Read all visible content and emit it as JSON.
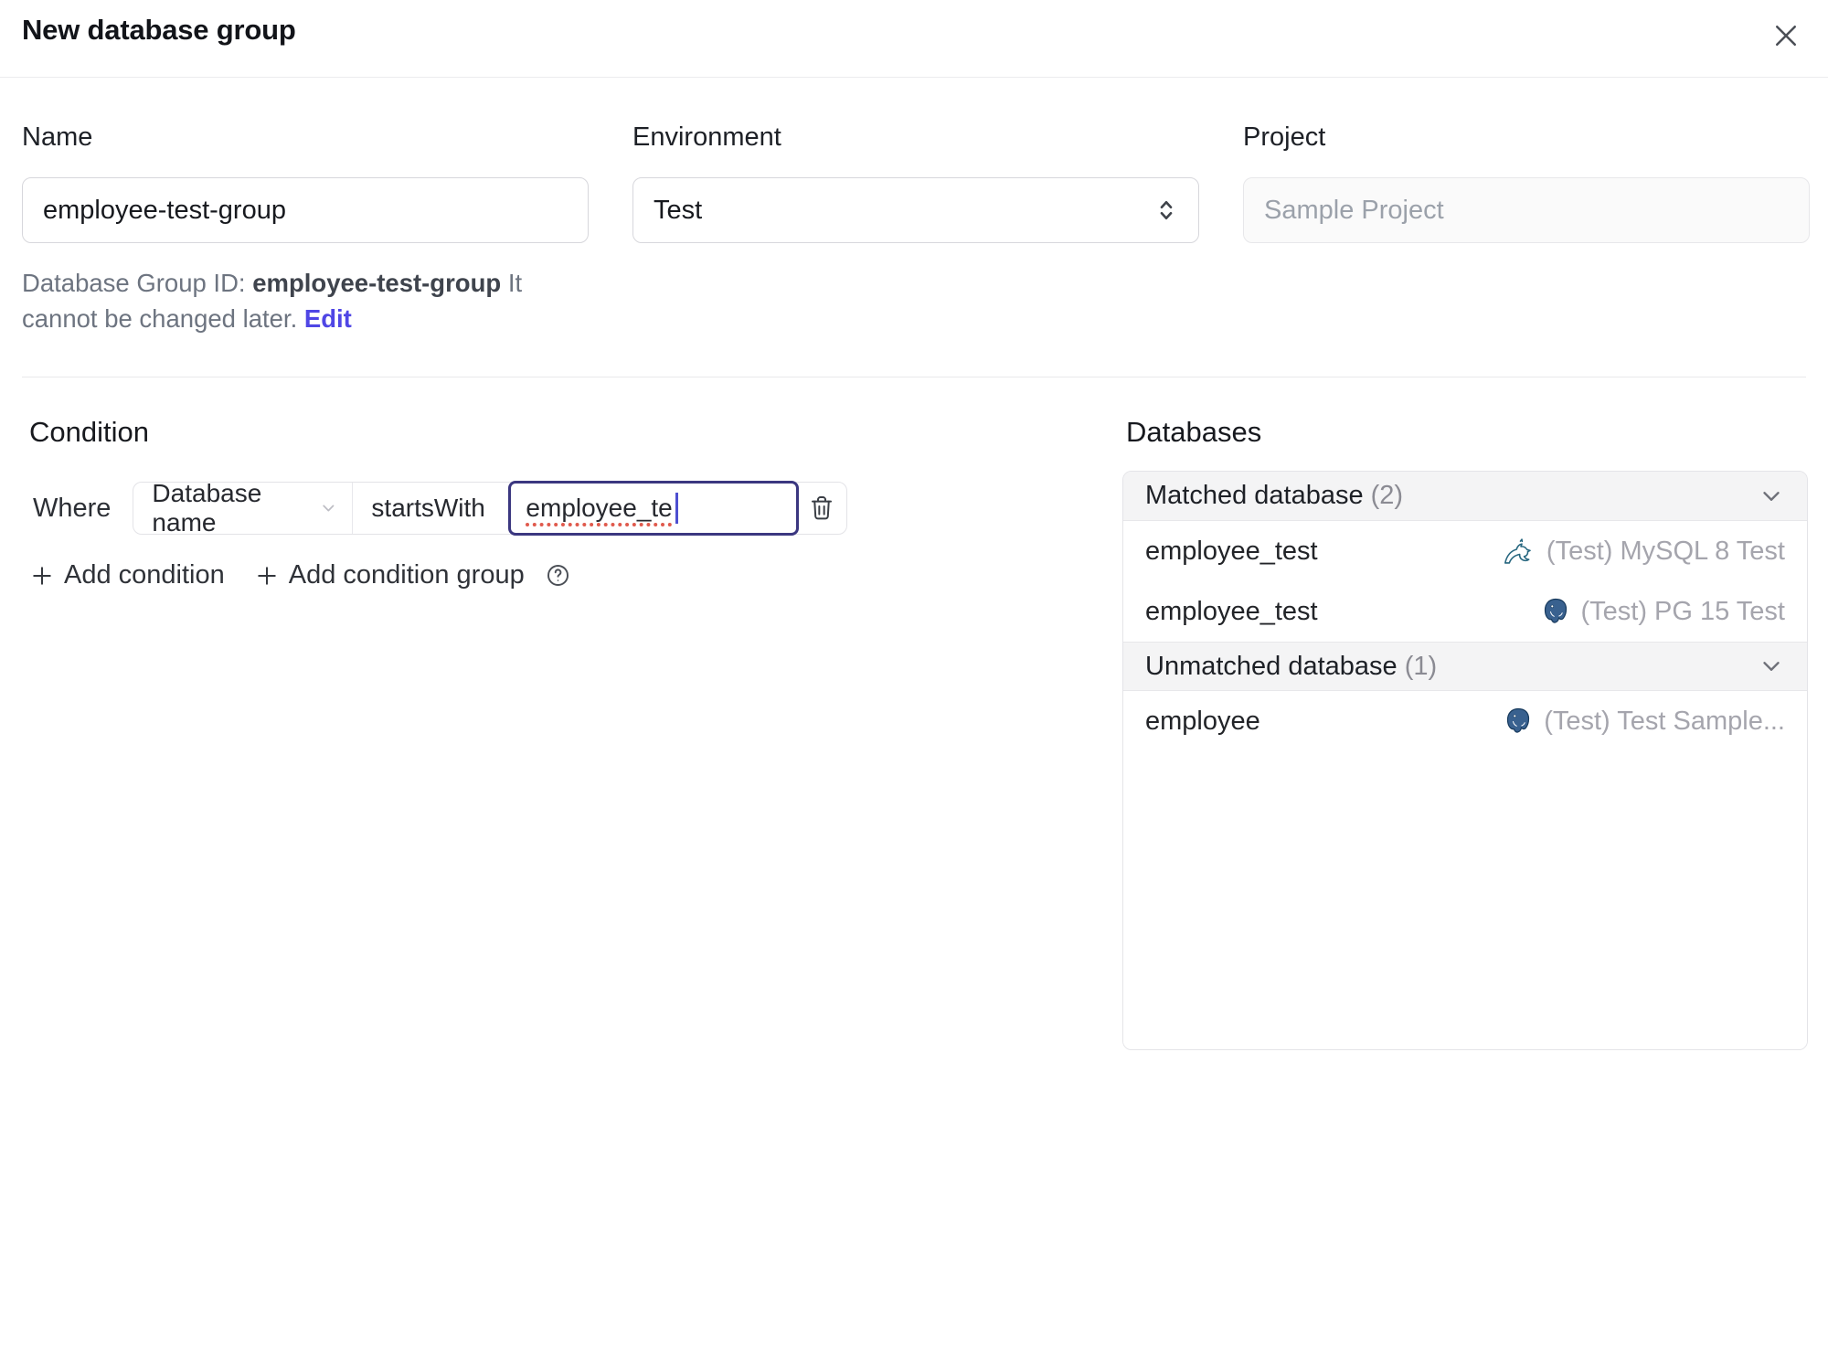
{
  "header": {
    "title": "New database group"
  },
  "form": {
    "name": {
      "label": "Name",
      "value": "employee-test-group"
    },
    "environment": {
      "label": "Environment",
      "value": "Test"
    },
    "project": {
      "label": "Project",
      "value": "Sample Project"
    },
    "group_id": {
      "prefix": "Database Group ID:",
      "value": "employee-test-group",
      "note": "It cannot be changed later.",
      "edit": "Edit"
    }
  },
  "condition": {
    "heading": "Condition",
    "where": "Where",
    "field": "Database name",
    "operator": "startsWith",
    "value": "employee_te",
    "add_condition": "Add condition",
    "add_condition_group": "Add condition group"
  },
  "databases": {
    "heading": "Databases",
    "matched": {
      "title": "Matched database",
      "count": "(2)",
      "rows": [
        {
          "name": "employee_test",
          "engine": "mysql",
          "instance": "(Test) MySQL 8 Test"
        },
        {
          "name": "employee_test",
          "engine": "postgresql",
          "instance": "(Test) PG 15 Test"
        }
      ]
    },
    "unmatched": {
      "title": "Unmatched database",
      "count": "(1)",
      "rows": [
        {
          "name": "employee",
          "engine": "postgresql",
          "instance": "(Test) Test Sample..."
        }
      ]
    }
  },
  "colors": {
    "accent": "#4f46e5",
    "focus_border": "#3b3780",
    "spellcheck_underline": "#e05a4d",
    "muted_text": "#a5a5ad",
    "header_bg": "#f4f4f5",
    "mysql_icon": "#26667f",
    "postgres_icon": "#39618f"
  }
}
